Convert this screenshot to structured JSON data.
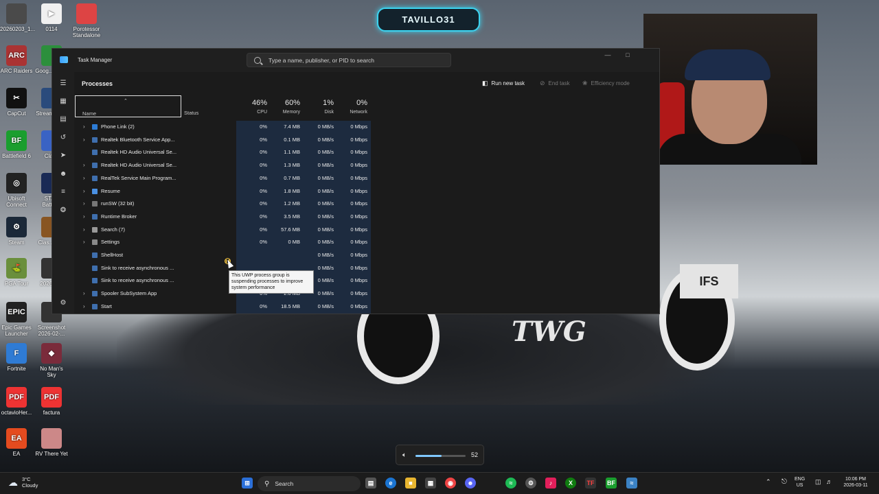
{
  "badge": {
    "name": "TAVILLO31"
  },
  "desktop_icons": [
    {
      "label": "20260203_1...",
      "color": "#4a4a4a",
      "glyph": ""
    },
    {
      "label": "0114",
      "color": "#f0f0f0",
      "glyph": "▶"
    },
    {
      "label": "Porotessor Standalone",
      "color": "#d44",
      "glyph": ""
    },
    {
      "label": "ARC Raiders",
      "color": "#a33",
      "glyph": "ARC"
    },
    {
      "label": "Goog... Chr...",
      "color": "#2c8f3c",
      "glyph": ""
    },
    {
      "label": "CapCut",
      "color": "#111",
      "glyph": "✂"
    },
    {
      "label": "Stream SE...",
      "color": "#2a4b7c",
      "glyph": ""
    },
    {
      "label": "Battlefield 6",
      "color": "#1a9e2e",
      "glyph": "BF"
    },
    {
      "label": "Clash",
      "color": "#3a63c4",
      "glyph": ""
    },
    {
      "label": "Ubisoft Connect",
      "color": "#222",
      "glyph": "◎"
    },
    {
      "label": "STAR Battle...",
      "color": "#1a2a55",
      "glyph": ""
    },
    {
      "label": "Steam",
      "color": "#1b2838",
      "glyph": "⚙"
    },
    {
      "label": "Clas... Cl...",
      "color": "#885522",
      "glyph": ""
    },
    {
      "label": "PGA Tour",
      "color": "#6a8f3c",
      "glyph": "⛳"
    },
    {
      "label": "202602...",
      "color": "#333",
      "glyph": ""
    },
    {
      "label": "Epic Games Launcher",
      "color": "#222",
      "glyph": "EPIC"
    },
    {
      "label": "Screenshot 2026-02-...",
      "color": "#333",
      "glyph": ""
    },
    {
      "label": "Fortnite",
      "color": "#2f7bd4",
      "glyph": "F"
    },
    {
      "label": "No Man's Sky",
      "color": "#7a2b3b",
      "glyph": "◆"
    },
    {
      "label": "octavioHer...",
      "color": "#e33",
      "glyph": "PDF"
    },
    {
      "label": "factura",
      "color": "#e33",
      "glyph": "PDF"
    },
    {
      "label": "EA",
      "color": "#e44b1f",
      "glyph": "EA"
    },
    {
      "label": "RV There Yet",
      "color": "#c88",
      "glyph": ""
    }
  ],
  "window": {
    "title": "Task Manager",
    "search_placeholder": "Type a name, publisher, or PID to search",
    "page_title": "Processes",
    "toolbar": {
      "run_new_task": "Run new task",
      "end_task": "End task",
      "efficiency_mode": "Efficiency mode"
    },
    "columns": {
      "name": "Name",
      "status": "Status",
      "cpu_pct": "46%",
      "cpu": "CPU",
      "memory_pct": "60%",
      "memory": "Memory",
      "disk_pct": "1%",
      "disk": "Disk",
      "network_pct": "0%",
      "network": "Network"
    },
    "processes": [
      {
        "name": "Phone Link (2)",
        "expand": true,
        "icon": "#2d7cd6",
        "cpu": "0%",
        "memory": "7.4 MB",
        "disk": "0 MB/s",
        "network": "0 Mbps"
      },
      {
        "name": "Realtek Bluetooth Service App...",
        "expand": true,
        "icon": "#3f6fae",
        "cpu": "0%",
        "memory": "0.1 MB",
        "disk": "0 MB/s",
        "network": "0 Mbps"
      },
      {
        "name": "Realtek HD Audio Universal Se...",
        "expand": false,
        "icon": "#3f6fae",
        "cpu": "0%",
        "memory": "1.1 MB",
        "disk": "0 MB/s",
        "network": "0 Mbps"
      },
      {
        "name": "Realtek HD Audio Universal Se...",
        "expand": true,
        "icon": "#3f6fae",
        "cpu": "0%",
        "memory": "1.3 MB",
        "disk": "0 MB/s",
        "network": "0 Mbps"
      },
      {
        "name": "RealTek Service Main Program...",
        "expand": true,
        "icon": "#3f6fae",
        "cpu": "0%",
        "memory": "0.7 MB",
        "disk": "0 MB/s",
        "network": "0 Mbps"
      },
      {
        "name": "Resume",
        "expand": true,
        "icon": "#4a90e2",
        "cpu": "0%",
        "memory": "1.8 MB",
        "disk": "0 MB/s",
        "network": "0 Mbps"
      },
      {
        "name": "runSW (32 bit)",
        "expand": true,
        "icon": "#777777",
        "cpu": "0%",
        "memory": "1.2 MB",
        "disk": "0 MB/s",
        "network": "0 Mbps"
      },
      {
        "name": "Runtime Broker",
        "expand": true,
        "icon": "#3f6fae",
        "cpu": "0%",
        "memory": "3.5 MB",
        "disk": "0 MB/s",
        "network": "0 Mbps"
      },
      {
        "name": "Search (7)",
        "expand": true,
        "icon": "#999999",
        "cpu": "0%",
        "memory": "57.6 MB",
        "disk": "0 MB/s",
        "network": "0 Mbps"
      },
      {
        "name": "Settings",
        "expand": true,
        "icon": "#8a8a8a",
        "cpu": "0%",
        "memory": "0 MB",
        "disk": "0 MB/s",
        "network": "0 Mbps"
      },
      {
        "name": "ShellHost",
        "expand": false,
        "icon": "#3f6fae",
        "cpu": "",
        "memory": "",
        "disk": "0 MB/s",
        "network": "0 Mbps"
      },
      {
        "name": "Sink to receive asynchronous ...",
        "expand": false,
        "icon": "#3f6fae",
        "cpu": "",
        "memory": "",
        "disk": "0 MB/s",
        "network": "0 Mbps"
      },
      {
        "name": "Sink to receive asynchronous ...",
        "expand": false,
        "icon": "#3f6fae",
        "cpu": "0%",
        "memory": "0.7 MB",
        "disk": "0 MB/s",
        "network": "0 Mbps"
      },
      {
        "name": "Spooler SubSystem App",
        "expand": true,
        "icon": "#3f6fae",
        "cpu": "0%",
        "memory": "2.0 MB",
        "disk": "0 MB/s",
        "network": "0 Mbps"
      },
      {
        "name": "Start",
        "expand": true,
        "icon": "#3f6fae",
        "cpu": "0%",
        "memory": "18.5 MB",
        "disk": "0 MB/s",
        "network": "0 Mbps"
      }
    ],
    "tooltip": "This UWP process group is suspending processes to improve system performance"
  },
  "volume": {
    "value": "52",
    "level": 0.52
  },
  "taskbar": {
    "weather_temp": "3°C",
    "weather_desc": "Cloudy",
    "search_label": "Search",
    "lang_top": "ENG",
    "lang_bottom": "US",
    "time": "10:06 PM",
    "date": "2026-03-11"
  },
  "wallpaper": {
    "livery": "TWG",
    "sponsor": "IFS"
  }
}
